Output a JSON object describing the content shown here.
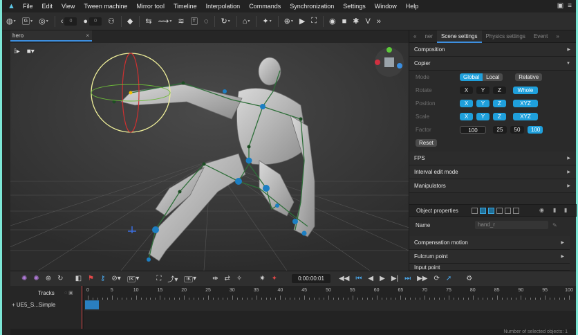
{
  "menu": {
    "items": [
      "File",
      "Edit",
      "View",
      "Tween machine",
      "Mirror tool",
      "Timeline",
      "Interpolation",
      "Commands",
      "Synchronization",
      "Settings",
      "Window",
      "Help"
    ]
  },
  "toolbar": {
    "g_label": "G",
    "r_label": "R",
    "field1": "0",
    "field2": "0",
    "t_label": "T"
  },
  "doc_tab": {
    "title": "hero",
    "close": "×"
  },
  "panel": {
    "tabs": [
      "ner",
      "Scene settings",
      "Physics settings",
      "Event"
    ],
    "sections": {
      "composition": "Composition",
      "copier": "Copier",
      "fps": "FPS",
      "interval": "Interval edit mode",
      "manipulators": "Manipulators",
      "compensation": "Compensation motion",
      "fulcrum": "Fulcrum point",
      "cut": "Input point"
    },
    "copier": {
      "mode_label": "Mode",
      "mode_global": "Global",
      "mode_local": "Local",
      "mode_relative": "Relative",
      "rotate_label": "Rotate",
      "position_label": "Position",
      "scale_label": "Scale",
      "x": "X",
      "y": "Y",
      "z": "Z",
      "whole": "Whole",
      "xyz": "XYZ",
      "factor_label": "Factor",
      "factor_value": "100",
      "f25": "25",
      "f50": "50",
      "f100": "100",
      "reset": "Reset"
    },
    "object_properties": "Object properties",
    "name_label": "Name",
    "name_value": "hand_r"
  },
  "timeline": {
    "time": "0:00:00:01",
    "ik1": "IK",
    "ik2": "IK",
    "tracks_label": "Tracks",
    "track_name": "+ UE5_S...Simple",
    "ruler": [
      "0",
      "5",
      "10",
      "15",
      "20",
      "25",
      "30",
      "35",
      "40",
      "45",
      "50",
      "55",
      "60",
      "65",
      "70",
      "75",
      "80",
      "85",
      "90",
      "95",
      "100"
    ],
    "status": "Number of selected objects: 1"
  },
  "colors": {
    "accent": "#1fa0dc",
    "bone": "#2f6f3a",
    "gizmo": "#f0f09a"
  }
}
